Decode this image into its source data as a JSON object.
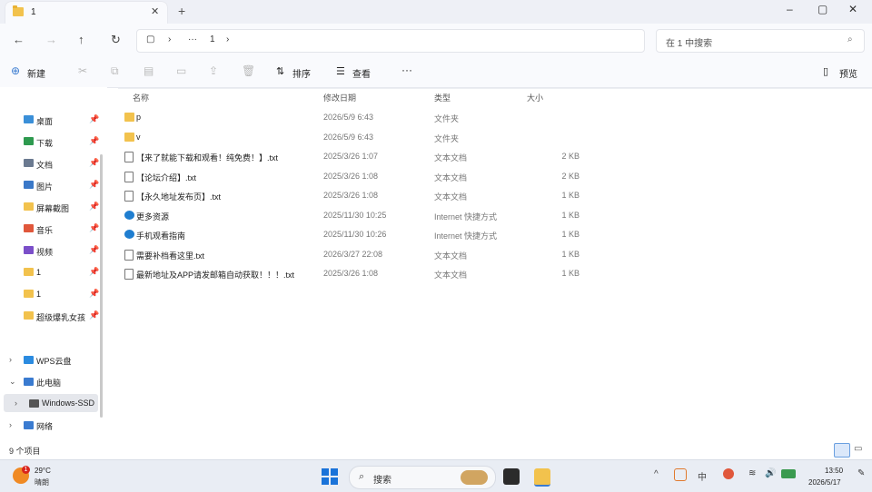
{
  "tab": {
    "title": "1",
    "close": "✕",
    "new": "+"
  },
  "window": {
    "minimize": "–",
    "maximize": "▢",
    "close": "✕"
  },
  "nav": {
    "back": "←",
    "forward": "→",
    "up": "↑",
    "refresh": "↻"
  },
  "address": {
    "monitor": "▢",
    "sep1": "›",
    "more": "···",
    "folder": "1",
    "sep2": "›"
  },
  "search": {
    "placeholder": "在 1 中搜索",
    "icon": "⌕"
  },
  "toolbar": {
    "new_label": "新建",
    "new_icon": "⊕",
    "sort_label": "排序",
    "sort_icon": "⇅",
    "view_label": "查看",
    "view_icon": "☰",
    "more": "···",
    "preview_label": "预览",
    "preview_icon": "▯"
  },
  "sidebar": {
    "quick": [
      {
        "label": "桌面",
        "color": "#3a8fd8"
      },
      {
        "label": "下载",
        "color": "#2e9a4f"
      },
      {
        "label": "文档",
        "color": "#6b7a90"
      },
      {
        "label": "图片",
        "color": "#3a78c8"
      },
      {
        "label": "屏幕截图",
        "color": "#f2c24d"
      },
      {
        "label": "音乐",
        "color": "#e0573b"
      },
      {
        "label": "视频",
        "color": "#7b4fc9"
      },
      {
        "label": "1",
        "color": "#f2c24d"
      },
      {
        "label": "1",
        "color": "#f2c24d"
      },
      {
        "label": "超级爆乳女孩",
        "color": "#f2c24d"
      }
    ],
    "pin": "📌",
    "tree": [
      {
        "chev": "›",
        "label": "WPS云盘",
        "color": "#2b8be0"
      },
      {
        "chev": "⌄",
        "label": "此电脑",
        "color": "#3a7bd0"
      },
      {
        "chev": "›",
        "label": "Windows-SSD",
        "color": "#555"
      },
      {
        "chev": "›",
        "label": "网络",
        "color": "#3a7bd0"
      }
    ]
  },
  "columns": {
    "name": "名称",
    "date": "修改日期",
    "type": "类型",
    "size": "大小"
  },
  "files": [
    {
      "name": "p",
      "date": "2026/5/9 6:43",
      "type": "文件夹",
      "size": "",
      "kind": "folder"
    },
    {
      "name": "v",
      "date": "2026/5/9 6:43",
      "type": "文件夹",
      "size": "",
      "kind": "folder"
    },
    {
      "name": "【来了就能下载和观看！纯免费！】.txt",
      "date": "2025/3/26 1:07",
      "type": "文本文档",
      "size": "2 KB",
      "kind": "txt"
    },
    {
      "name": "【论坛介绍】.txt",
      "date": "2025/3/26 1:08",
      "type": "文本文档",
      "size": "2 KB",
      "kind": "txt"
    },
    {
      "name": "【永久地址发布页】.txt",
      "date": "2025/3/26 1:08",
      "type": "文本文档",
      "size": "1 KB",
      "kind": "txt"
    },
    {
      "name": "更多资源",
      "date": "2025/11/30 10:25",
      "type": "Internet 快捷方式",
      "size": "1 KB",
      "kind": "url"
    },
    {
      "name": "手机观看指南",
      "date": "2025/11/30 10:26",
      "type": "Internet 快捷方式",
      "size": "1 KB",
      "kind": "url"
    },
    {
      "name": "需要补档看这里.txt",
      "date": "2026/3/27 22:08",
      "type": "文本文档",
      "size": "1 KB",
      "kind": "txt"
    },
    {
      "name": "最新地址及APP请发邮箱自动获取！！！.txt",
      "date": "2025/3/26 1:08",
      "type": "文本文档",
      "size": "1 KB",
      "kind": "txt"
    }
  ],
  "status": {
    "count": "9 个项目"
  },
  "taskbar": {
    "temperature": "29°C",
    "condition": "晴朗",
    "badge": "1",
    "search_placeholder": "搜索",
    "search_icon": "⌕",
    "tray": {
      "chevron": "^",
      "ime": "中",
      "wifi": "≋",
      "sound": "🔊"
    },
    "time": "13:50",
    "date": "2026/5/17"
  }
}
